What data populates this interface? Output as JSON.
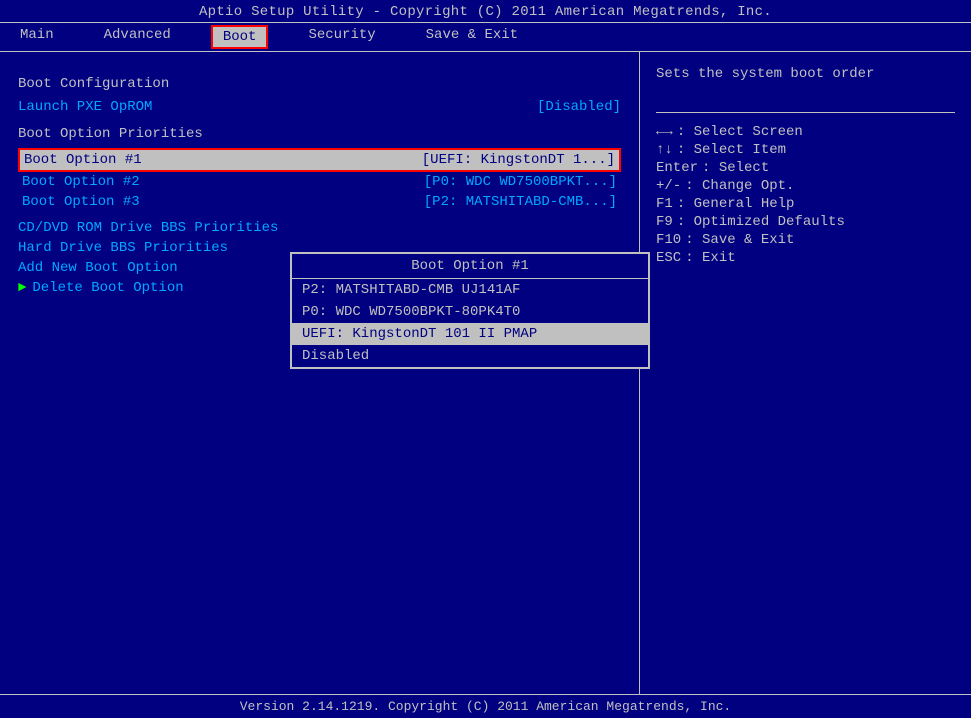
{
  "title": "Aptio Setup Utility - Copyright (C) 2011 American Megatrends, Inc.",
  "footer": "Version 2.14.1219. Copyright (C) 2011 American Megatrends, Inc.",
  "menu": {
    "items": [
      {
        "id": "main",
        "label": "Main",
        "active": false
      },
      {
        "id": "advanced",
        "label": "Advanced",
        "active": false
      },
      {
        "id": "boot",
        "label": "Boot",
        "active": true
      },
      {
        "id": "security",
        "label": "Security",
        "active": false
      },
      {
        "id": "save-exit",
        "label": "Save & Exit",
        "active": false
      }
    ]
  },
  "left": {
    "section1_title": "Boot Configuration",
    "launch_pxe_label": "Launch PXE OpROM",
    "launch_pxe_value": "[Disabled]",
    "section2_title": "Boot Option Priorities",
    "boot_options": [
      {
        "label": "Boot Option #1",
        "value": "[UEFI: KingstonDT 1...]",
        "selected": true
      },
      {
        "label": "Boot Option #2",
        "value": "[P0: WDC WD7500BPKT...]"
      },
      {
        "label": "Boot Option #3",
        "value": "[P2: MATSHITABD-CMB...]"
      }
    ],
    "section3_title": "CD/DVD ROM Drive BBS Priorities",
    "hard_drive_bbs": "Hard Drive BBS Priorities",
    "add_new_boot": "Add New Boot Option",
    "delete_boot": "Delete Boot Option"
  },
  "dropdown": {
    "title": "Boot Option #1",
    "items": [
      {
        "label": "P2: MATSHITABD-CMB UJ141AF",
        "highlighted": false
      },
      {
        "label": "P0: WDC WD7500BPKT-80PK4T0",
        "highlighted": false
      },
      {
        "label": "UEFI: KingstonDT 101 II PMAP",
        "highlighted": true
      },
      {
        "label": "Disabled",
        "highlighted": false
      }
    ]
  },
  "right": {
    "help_text": "Sets the system boot order",
    "keys": [
      {
        "key": "←→",
        "desc": ": Select Screen"
      },
      {
        "key": "↑↓",
        "desc": ": Select Item"
      },
      {
        "key": "Enter",
        "desc": ": Select"
      },
      {
        "key": "+/-",
        "desc": ": Change Opt."
      },
      {
        "key": "F1",
        "desc": ": General Help"
      },
      {
        "key": "F9",
        "desc": ": Optimized Defaults"
      },
      {
        "key": "F10",
        "desc": ": Save & Exit"
      },
      {
        "key": "ESC",
        "desc": ": Exit"
      }
    ]
  }
}
